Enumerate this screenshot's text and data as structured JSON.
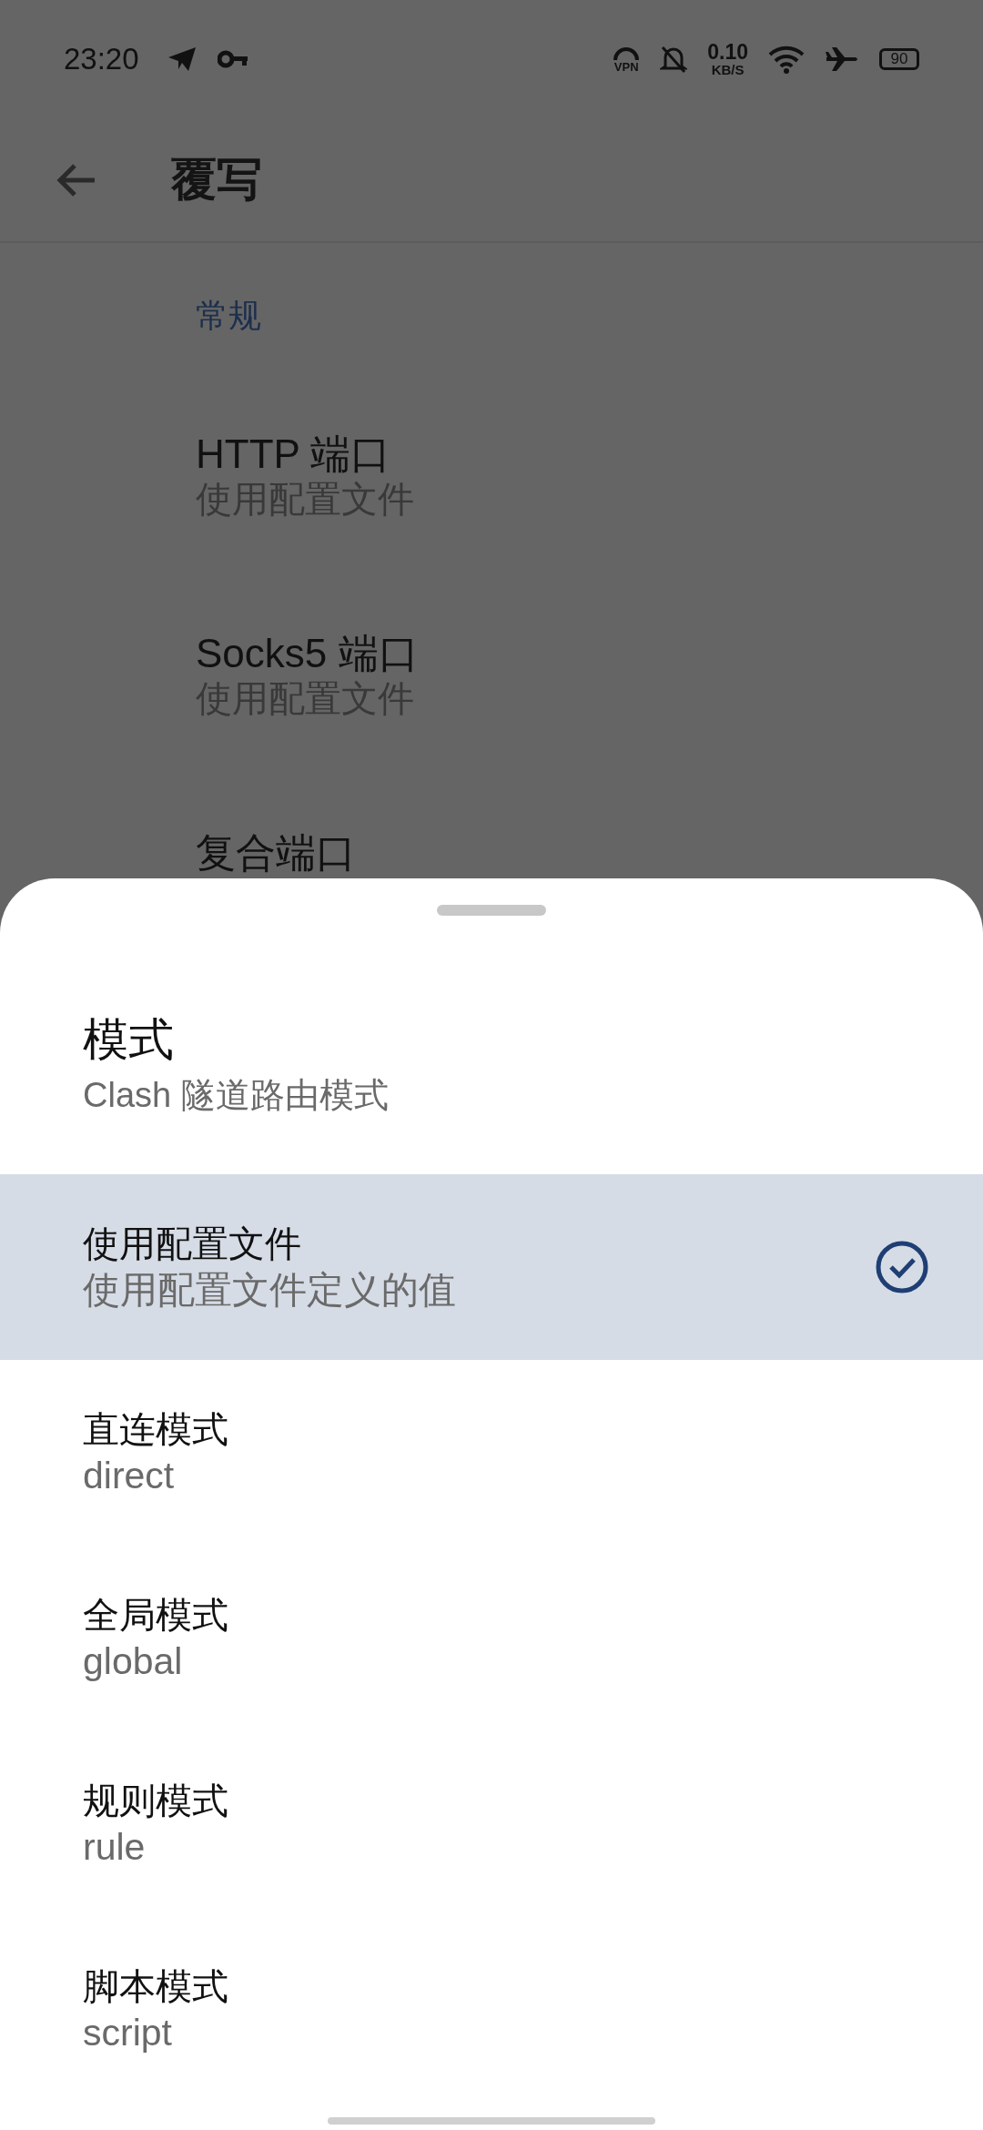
{
  "status_bar": {
    "time": "23:20",
    "vpn_label": "VPN",
    "speed": "0.10",
    "speed_unit": "KB/S",
    "battery": "90"
  },
  "app_bar": {
    "title": "覆写"
  },
  "section": {
    "header": "常规",
    "items": [
      {
        "title": "HTTP 端口",
        "subtitle": "使用配置文件"
      },
      {
        "title": "Socks5 端口",
        "subtitle": "使用配置文件"
      },
      {
        "title": "复合端口"
      }
    ]
  },
  "sheet": {
    "title": "模式",
    "subtitle": "Clash 隧道路由模式",
    "options": [
      {
        "title": "使用配置文件",
        "subtitle": "使用配置文件定义的值",
        "selected": true
      },
      {
        "title": "直连模式",
        "subtitle": "direct",
        "selected": false
      },
      {
        "title": "全局模式",
        "subtitle": "global",
        "selected": false
      },
      {
        "title": "规则模式",
        "subtitle": "rule",
        "selected": false
      },
      {
        "title": "脚本模式",
        "subtitle": "script",
        "selected": false
      }
    ]
  }
}
